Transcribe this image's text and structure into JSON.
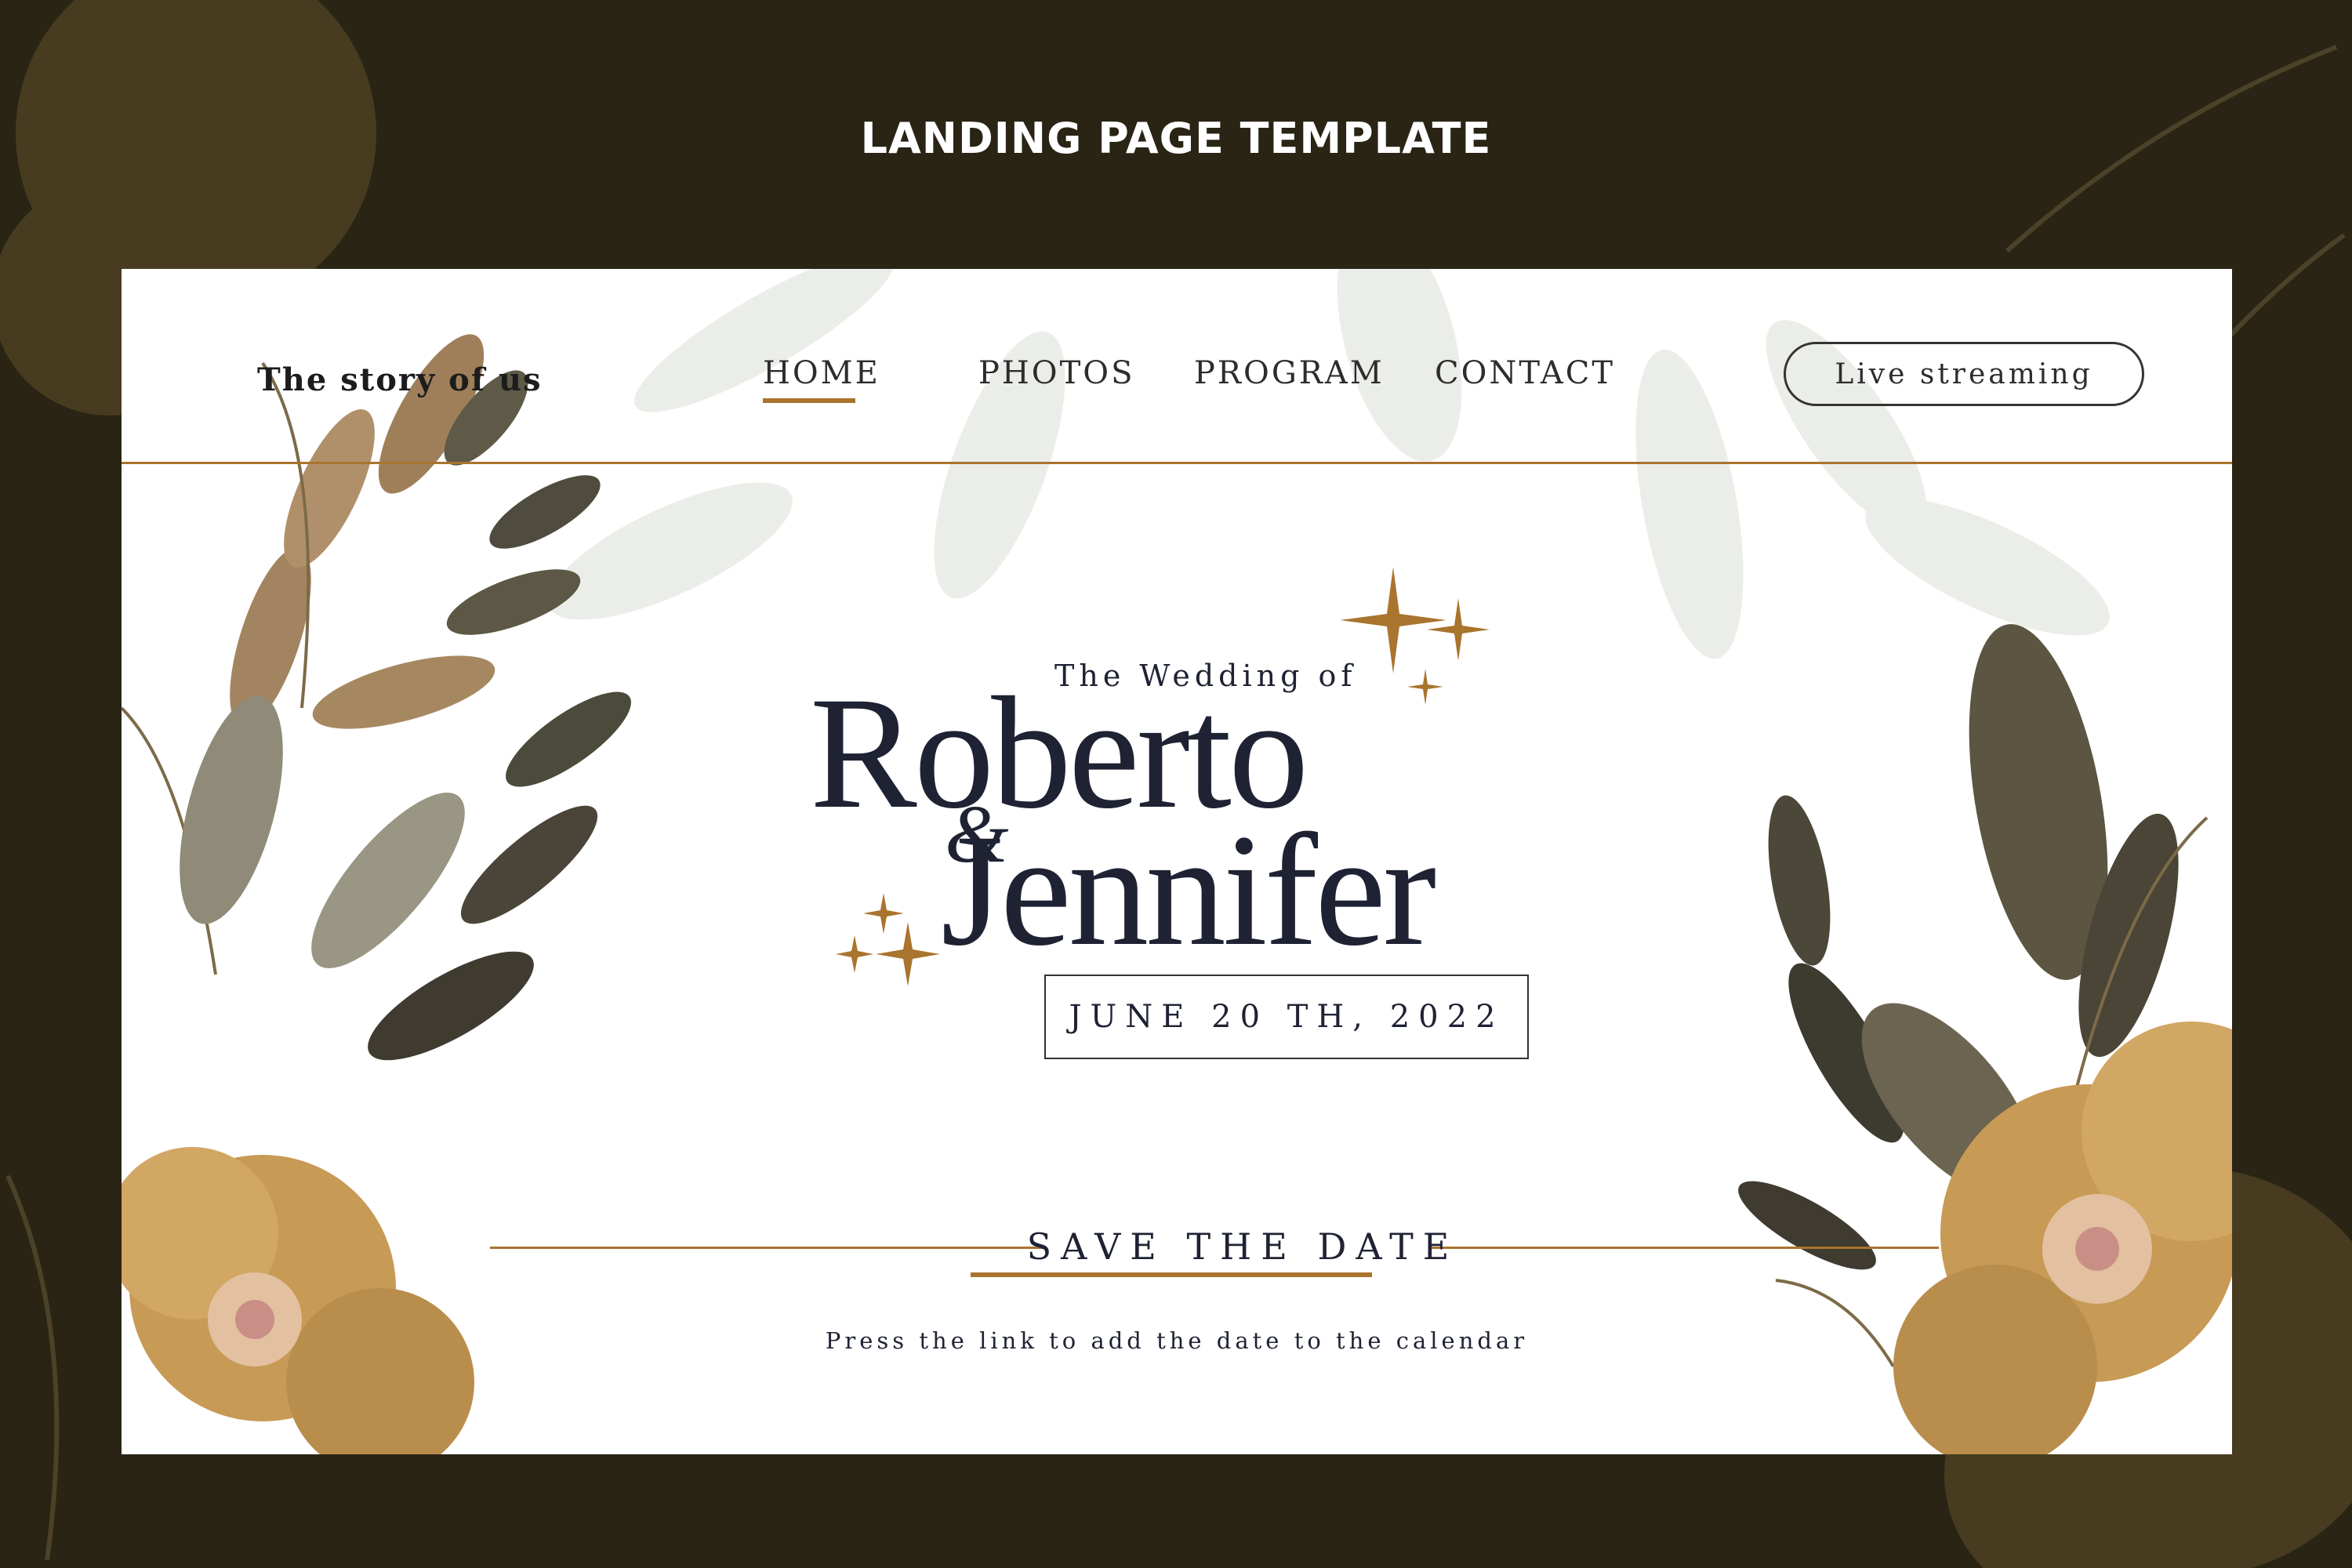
{
  "frame": {
    "title": "LANDING PAGE TEMPLATE"
  },
  "header": {
    "brand": "The story of us",
    "nav": [
      "HOME",
      "PHOTOS",
      "PROGRAM",
      "CONTACT"
    ],
    "active_nav": "HOME",
    "cta": "Live streaming"
  },
  "hero": {
    "pre_title": "The Wedding of",
    "name_1": "Roberto",
    "ampersand": "&",
    "name_2": "Jennifer",
    "date": "JUNE 20 TH, 2022"
  },
  "save_the_date": {
    "label": "SAVE THE DATE",
    "hint": "Press the link to add the date to the calendar"
  },
  "colors": {
    "background": "#2a2414",
    "card": "#ffffff",
    "accent": "#a9742e",
    "text": "#1e2233"
  },
  "decorations": {
    "sparkle": "sparkle-icon",
    "foliage": "botanical-illustration"
  }
}
